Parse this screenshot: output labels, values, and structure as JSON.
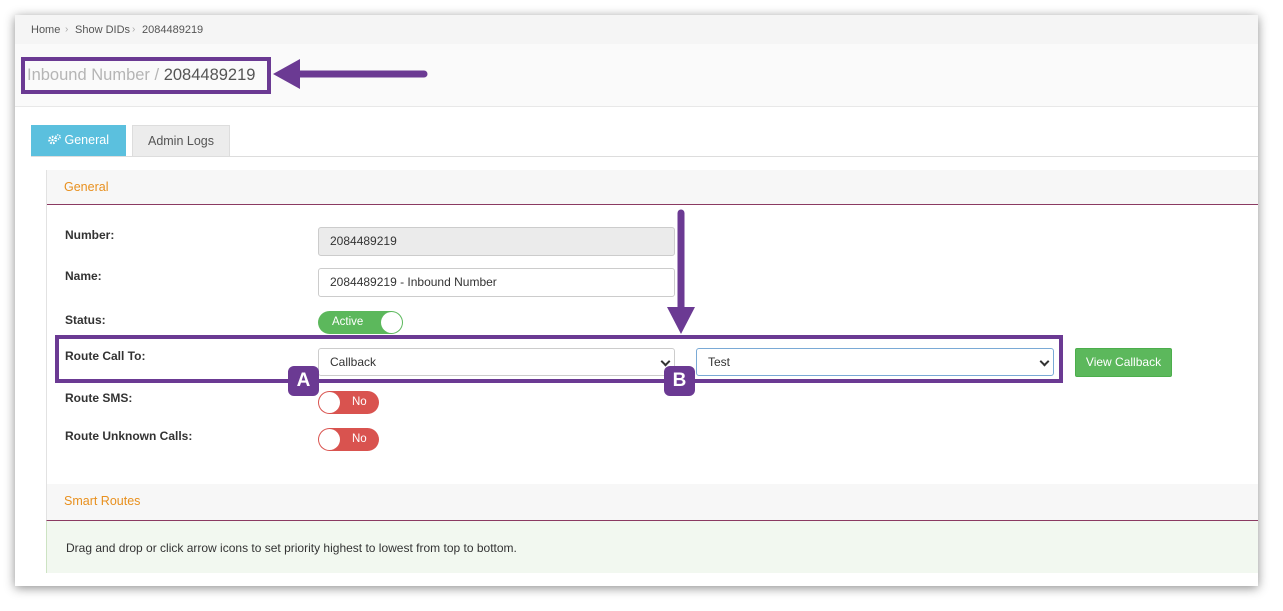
{
  "breadcrumb": {
    "home": "Home",
    "show_dids": "Show DIDs",
    "current": "2084489219"
  },
  "page_title": {
    "prefix": "Inbound Number /",
    "number": "2084489219"
  },
  "tabs": [
    {
      "label": "General",
      "icon": "cogs-icon",
      "active": true
    },
    {
      "label": "Admin Logs",
      "active": false
    }
  ],
  "general_panel": {
    "heading": "General",
    "number_label": "Number:",
    "number_value": "2084489219",
    "name_label": "Name:",
    "name_value": "2084489219 - Inbound Number",
    "status_label": "Status:",
    "status_toggle": "Active",
    "route_call_label": "Route Call To:",
    "route_call_value": "Callback",
    "route_target_value": "Test",
    "view_button": "View Callback",
    "route_sms_label": "Route SMS:",
    "route_sms_toggle": "No",
    "route_unknown_label": "Route Unknown Calls:",
    "route_unknown_toggle": "No"
  },
  "smart_routes": {
    "heading": "Smart Routes",
    "info": "Drag and drop or click arrow icons to set priority highest to lowest from top to bottom."
  },
  "annotations": {
    "badge_a": "A",
    "badge_b": "B"
  },
  "colors": {
    "accent_purple": "#6b3a93",
    "tab_active": "#5bc0de",
    "success": "#5cb85c",
    "danger": "#d9534f",
    "heading_orange": "#e8901e"
  }
}
